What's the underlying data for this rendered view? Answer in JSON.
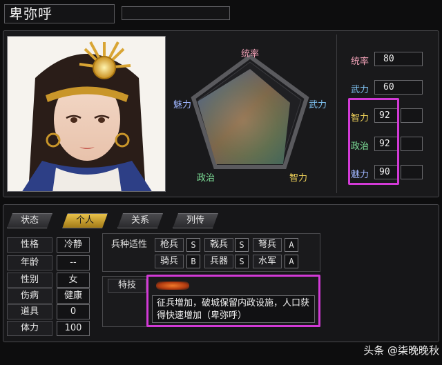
{
  "header": {
    "name": "卑弥呼",
    "title_box": ""
  },
  "radar": {
    "labels": {
      "leadership": "统率",
      "war": "武力",
      "intelligence": "智力",
      "politics": "政治",
      "charisma": "魅力"
    },
    "label_colors": {
      "leadership": "#f2a2b8",
      "war": "#7ec0f0",
      "intelligence": "#f0d35a",
      "politics": "#7fe29a",
      "charisma": "#9fb6ff"
    }
  },
  "stats": [
    {
      "label": "统率",
      "value": "80",
      "color": "#f2a2b8"
    },
    {
      "label": "武力",
      "value": "60",
      "color": "#7ec0f0"
    },
    {
      "label": "智力",
      "value": "92",
      "color": "#f0d35a"
    },
    {
      "label": "政治",
      "value": "92",
      "color": "#7fe29a"
    },
    {
      "label": "魅力",
      "value": "90",
      "color": "#9fb6ff"
    }
  ],
  "tabs": [
    {
      "label": "状态",
      "active": false
    },
    {
      "label": "个人",
      "active": true
    },
    {
      "label": "关系",
      "active": false
    },
    {
      "label": "列传",
      "active": false
    }
  ],
  "personal": [
    {
      "label": "性格",
      "value": "冷静"
    },
    {
      "label": "年龄",
      "value": "--"
    },
    {
      "label": "性别",
      "value": "女"
    },
    {
      "label": "伤病",
      "value": "健康"
    },
    {
      "label": "道具",
      "value": "0"
    },
    {
      "label": "体力",
      "value": "100"
    }
  ],
  "troops": {
    "label": "兵种适性",
    "items": [
      {
        "name": "枪兵",
        "grade": "S"
      },
      {
        "name": "戟兵",
        "grade": "S"
      },
      {
        "name": "弩兵",
        "grade": "A"
      },
      {
        "name": "骑兵",
        "grade": "B"
      },
      {
        "name": "兵器",
        "grade": "S"
      },
      {
        "name": "水军",
        "grade": "A"
      }
    ]
  },
  "skill": {
    "label": "特技",
    "name": "",
    "description": "征兵增加，破城保留内政设施，人口获得快速增加（卑弥呼）"
  },
  "watermark": "头条 @柒晚晚秋"
}
